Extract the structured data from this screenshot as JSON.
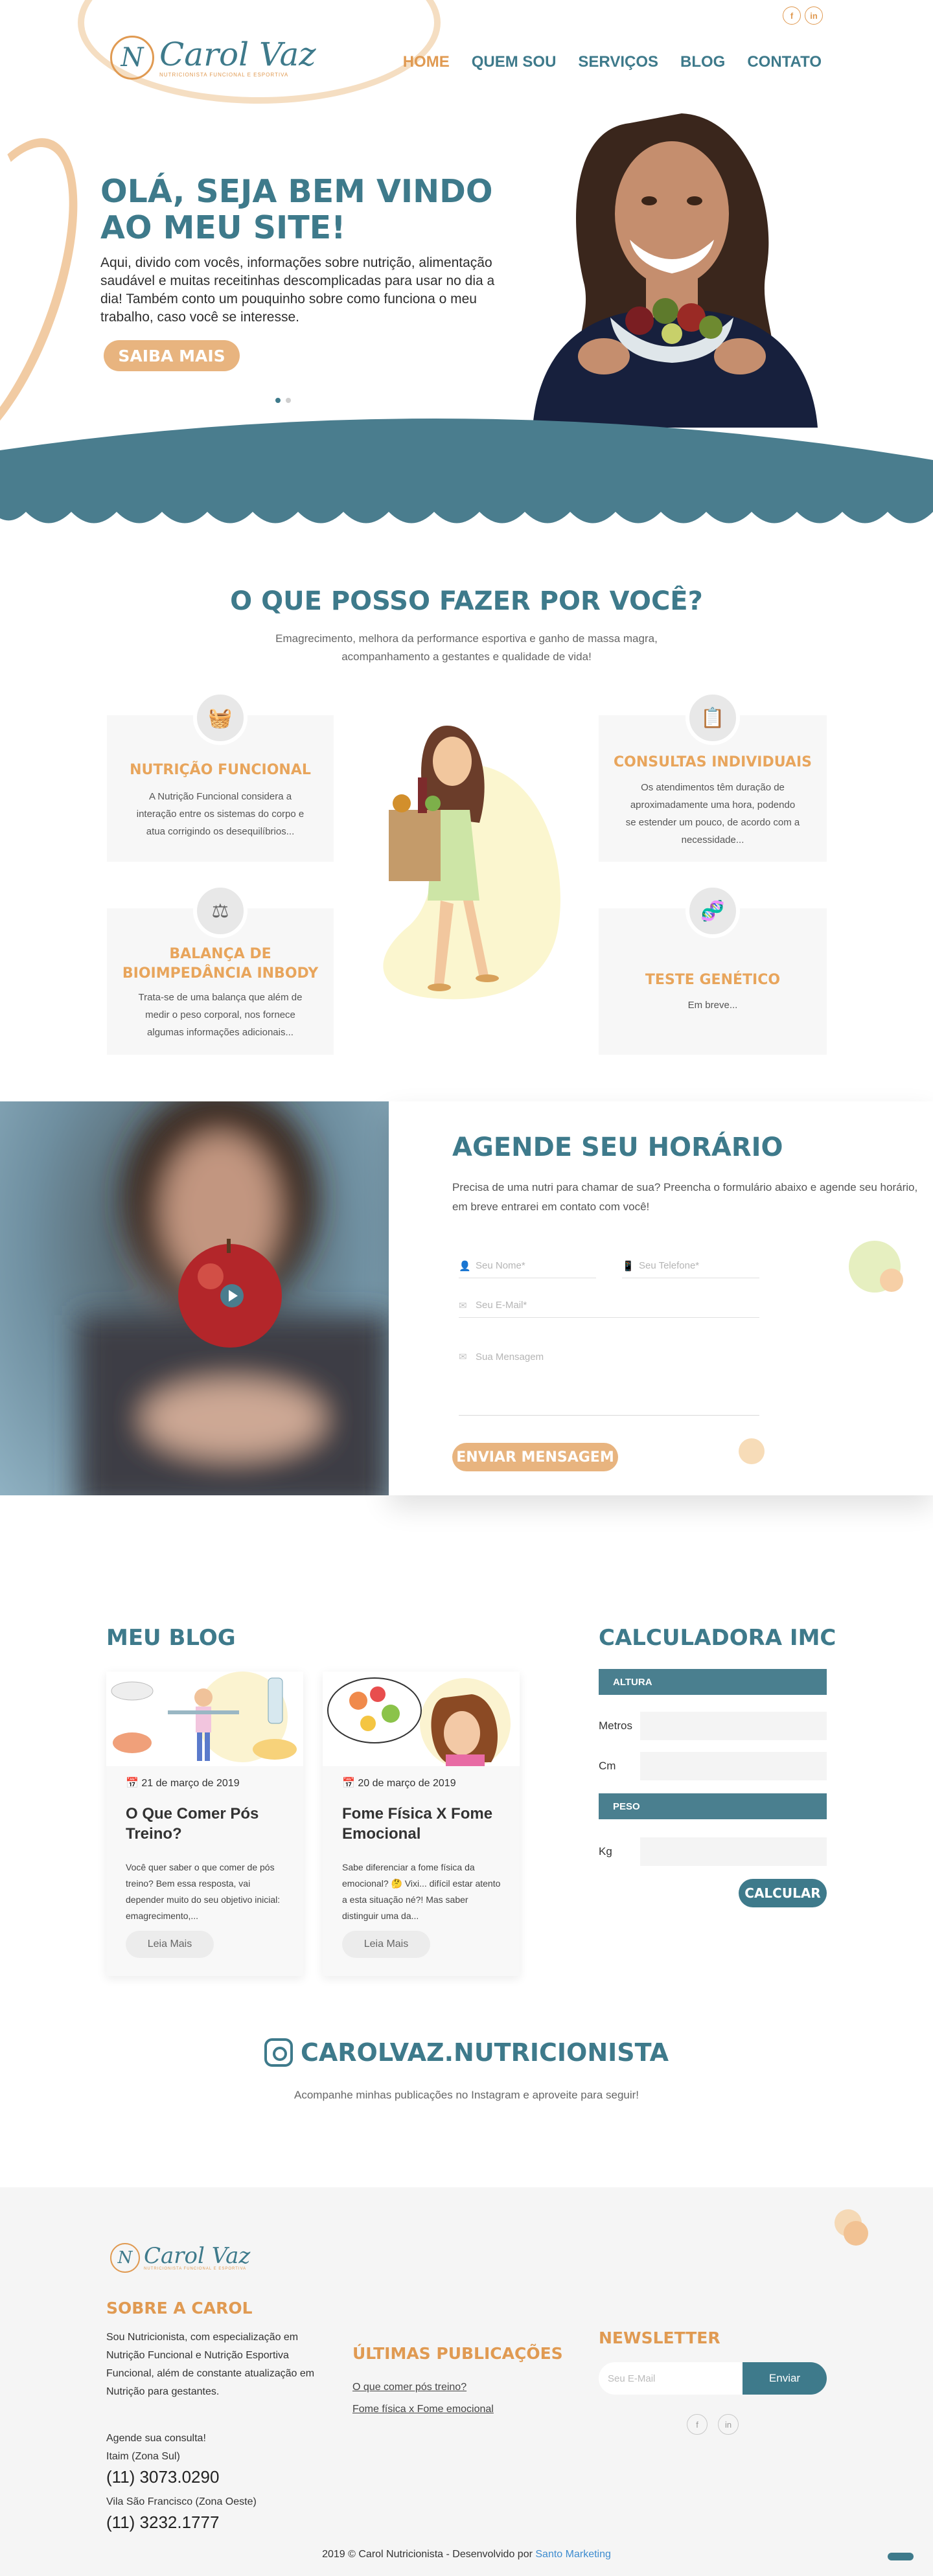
{
  "colors": {
    "teal": "#3e7a8b",
    "orange": "#e09a52",
    "peach": "#e8b47f",
    "light_bg": "#f7f7f7"
  },
  "header": {
    "logo_name": "Carol Vaz",
    "logo_monogram": "N",
    "logo_tagline": "NUTRICIONISTA FUNCIONAL E ESPORTIVA",
    "social": [
      {
        "icon": "facebook-icon",
        "glyph": "f"
      },
      {
        "icon": "linkedin-icon",
        "glyph": "in"
      }
    ],
    "nav": [
      "HOME",
      "QUEM SOU",
      "SERVIÇOS",
      "BLOG",
      "CONTATO"
    ]
  },
  "hero": {
    "title_line1": "OLÁ, SEJA BEM VINDO",
    "title_line2": "AO MEU SITE!",
    "text": "Aqui, divido com vocês, informações sobre nutrição, alimentação saudável e muitas receitinhas descomplicadas para usar no dia a dia! Também conto um pouquinho sobre como funciona o meu trabalho, caso você se interesse.",
    "button": "SAIBA MAIS",
    "slide_count": 2,
    "active_slide": 1
  },
  "services": {
    "title": "O QUE POSSO FAZER POR VOCÊ?",
    "subtitle": "Emagrecimento, melhora da performance esportiva e ganho de massa magra, acompanhamento a gestantes e qualidade de vida!",
    "cards": [
      {
        "icon": "food-basket-icon",
        "title": "NUTRIÇÃO FUNCIONAL",
        "text": "A Nutrição Funcional considera a interação entre os sistemas do corpo e atua corrigindo os desequilíbrios..."
      },
      {
        "icon": "clipboard-icon",
        "title": "CONSULTAS INDIVIDUAIS",
        "text": "Os atendimentos têm duração de aproximadamente uma hora, podendo se estender um pouco, de acordo com a necessidade..."
      },
      {
        "icon": "scale-icon",
        "title": "BALANÇA DE BIOIMPEDÂNCIA INBODY",
        "text": "Trata-se de uma balança que além de medir o peso corporal, nos fornece algumas informações adicionais..."
      },
      {
        "icon": "dna-test-icon",
        "title": "TESTE GENÉTICO",
        "text": "Em breve..."
      }
    ]
  },
  "agende": {
    "title": "AGENDE SEU HORÁRIO",
    "text": "Precisa de uma nutri para chamar de sua? Preencha o formulário abaixo e agende seu horário, em breve entrarei em contato com você!",
    "name_placeholder": "Seu Nome*",
    "phone_placeholder": "Seu Telefone*",
    "email_placeholder": "Seu E-Mail*",
    "message_placeholder": "Sua Mensagem",
    "button": "ENVIAR MENSAGEM"
  },
  "blog": {
    "title": "MEU BLOG",
    "posts": [
      {
        "date": "21 de março de 2019",
        "title": "O Que Comer Pós Treino?",
        "excerpt": "Você quer saber o que comer de pós treino? Bem essa resposta, vai depender muito do seu objetivo inicial: emagrecimento,...",
        "button": "Leia Mais"
      },
      {
        "date": "20 de março de 2019",
        "title": "Fome Física X Fome Emocional",
        "excerpt": "Sabe diferenciar a fome física da emocional? 🤔 Vixi... difícil estar atento a esta situação né?! Mas saber distinguir uma da...",
        "button": "Leia Mais"
      }
    ]
  },
  "imc": {
    "title": "CALCULADORA IMC",
    "section_height": "ALTURA",
    "label_meters": "Metros",
    "label_cm": "Cm",
    "section_weight": "PESO",
    "label_kg": "Kg",
    "button": "CALCULAR"
  },
  "instagram": {
    "handle": "CAROLVAZ.NUTRICIONISTA",
    "subtitle": "Acompanhe minhas publicações no Instagram e aproveite para seguir!"
  },
  "footer": {
    "about_title": "SOBRE A CAROL",
    "about_text": "Sou Nutricionista, com especialização em Nutrição Funcional e Nutrição Esportiva Funcional, além de constante atualização em Nutrição para gestantes.",
    "schedule": "Agende sua consulta!",
    "loc1": "Itaim (Zona Sul)",
    "phone1": "(11) 3073.0290",
    "loc2": "Vila São Francisco (Zona Oeste)",
    "phone2": "(11) 3232.1777",
    "latest_title": "ÚLTIMAS PUBLICAÇÕES",
    "latest_links": [
      "O que comer pós treino?",
      "Fome física x Fome emocional"
    ],
    "newsletter_title": "NEWSLETTER",
    "newsletter_placeholder": "Seu E-Mail",
    "newsletter_button": "Enviar",
    "copyright": "2019 © Carol Nutricionista - Desenvolvido por ",
    "dev": "Santo Marketing"
  }
}
